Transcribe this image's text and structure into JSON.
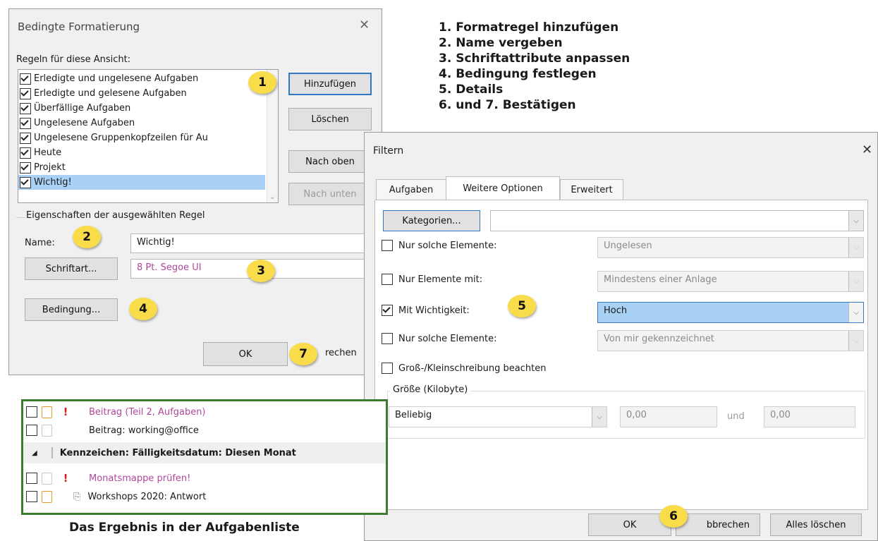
{
  "steps": [
    "1. Formatregel hinzufügen",
    "2. Name vergeben",
    "3. Schriftattribute anpassen",
    "4. Bedingung festlegen",
    "5. Details",
    "6. und 7. Bestätigen"
  ],
  "cf_dialog": {
    "title": "Bedingte Formatierung",
    "close": "✕",
    "rules_label": "Regeln für diese Ansicht:",
    "rules": [
      {
        "label": "Erledigte und ungelesene Aufgaben",
        "checked": true
      },
      {
        "label": "Erledigte und gelesene Aufgaben",
        "checked": true
      },
      {
        "label": "Überfällige Aufgaben",
        "checked": true
      },
      {
        "label": "Ungelesene Aufgaben",
        "checked": true
      },
      {
        "label": "Ungelesene Gruppenkopfzeilen für Au",
        "checked": true
      },
      {
        "label": "Heute",
        "checked": true
      },
      {
        "label": "Projekt",
        "checked": true
      },
      {
        "label": "Wichtig!",
        "checked": true,
        "selected": true
      }
    ],
    "btn_add": "Hinzufügen",
    "btn_delete": "Löschen",
    "btn_up": "Nach oben",
    "btn_down": "Nach unten",
    "props_label": "Eigenschaften der ausgewählten Regel",
    "name_label": "Name:",
    "name_value": "Wichtig!",
    "font_button": "Schriftart...",
    "font_value": "8 Pt. Segoe UI",
    "condition_button": "Bedingung...",
    "ok": "OK",
    "cancel_partial": "rechen"
  },
  "filter_dialog": {
    "title": "Filtern",
    "close": "✕",
    "tabs": [
      "Aufgaben",
      "Weitere Optionen",
      "Erweitert"
    ],
    "categories_button": "Kategorien...",
    "rows": [
      {
        "label": "Nur solche Elemente:",
        "checked": false,
        "value": "Ungelesen",
        "enabled": false
      },
      {
        "label": "Nur Elemente mit:",
        "checked": false,
        "value": "Mindestens einer Anlage",
        "enabled": false
      },
      {
        "label": "Mit Wichtigkeit:",
        "checked": true,
        "value": "Hoch",
        "enabled": true
      },
      {
        "label": "Nur solche Elemente:",
        "checked": false,
        "value": "Von mir gekennzeichnet",
        "enabled": false
      }
    ],
    "case_label": "Groß-/Kleinschreibung beachten",
    "size_group": "Größe (Kilobyte)",
    "size_select": "Beliebig",
    "size_from": "0,00",
    "size_and": "und",
    "size_to": "0,00",
    "ok": "OK",
    "cancel_partial": "bbrechen",
    "clear_all": "Alles löschen"
  },
  "bubbles": [
    "1",
    "2",
    "3",
    "4",
    "5",
    "6",
    "7"
  ],
  "result": {
    "caption": "Das Ergebnis in der Aufgabenliste",
    "tasks": [
      {
        "text": "Beitrag (Teil 2, Aufgaben)",
        "important": true,
        "pink": true
      },
      {
        "text": "Beitrag: working@office",
        "important": false,
        "pink": false
      },
      {
        "text": "Monatsmappe prüfen!",
        "important": true,
        "pink": true
      },
      {
        "text": "Workshops 2020: Antwort",
        "important": false,
        "pink": false,
        "attachment": true
      }
    ],
    "group_header": "Kennzeichen: Fälligkeitsdatum: Diesen Monat"
  },
  "colors": {
    "accent_blue": "#a9d0f5",
    "bubble_yellow": "#f8dc4a",
    "important_pink": "#b0479a",
    "important_red": "#d51e1e",
    "result_border": "#3b7d2c"
  }
}
